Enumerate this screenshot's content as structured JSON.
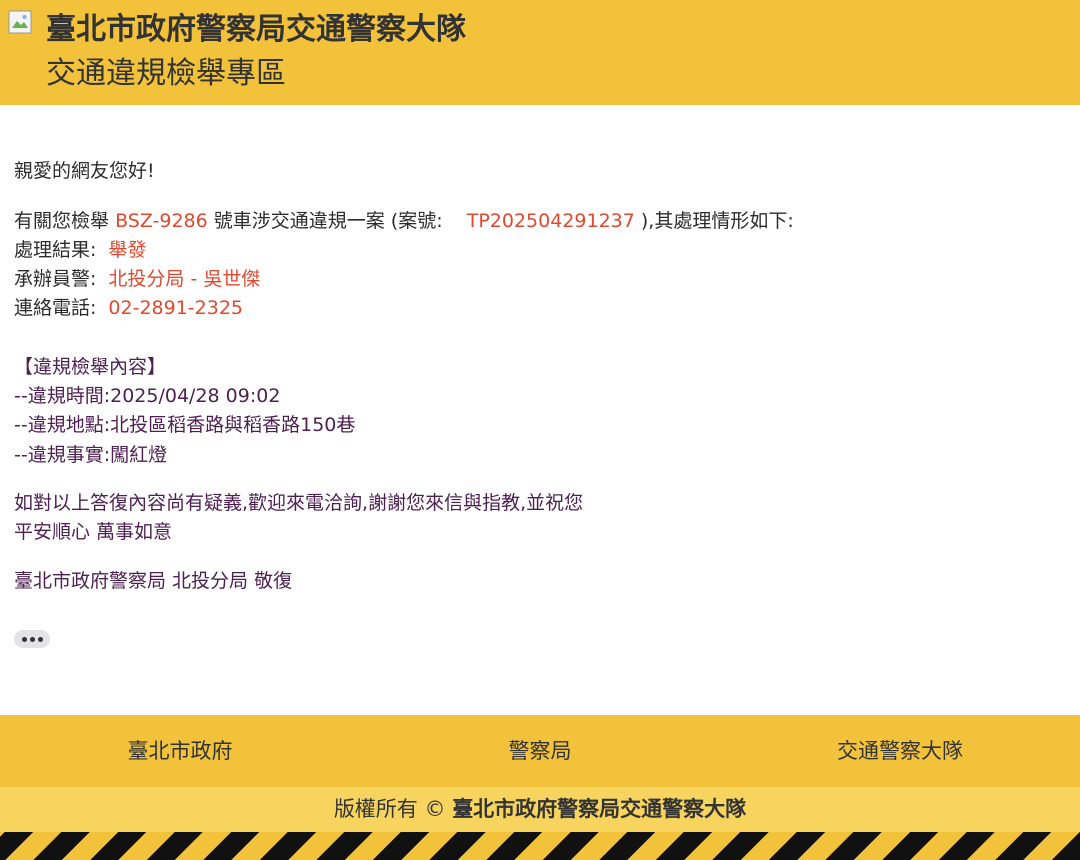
{
  "header": {
    "org_title": "臺北市政府警察局交通警察大隊",
    "section_title": "交通違規檢舉專區"
  },
  "message": {
    "greeting": "親愛的網友您好!",
    "intro_prefix": "有關您檢舉",
    "plate": "BSZ-9286",
    "intro_middle": "號車涉交通違規一案 (案號:",
    "case_number": "TP202504291237",
    "intro_suffix": "),其處理情形如下:",
    "result_label": "處理結果:",
    "result_value": "舉發",
    "officer_label": "承辦員警:",
    "officer_value": "北投分局 - 吳世傑",
    "phone_label": "連絡電話:",
    "phone_value": "02-2891-2325",
    "report_heading": "【違規檢舉內容】",
    "time_label": "--違規時間:",
    "time_value": "2025/04/28 09:02",
    "place_label": "--違規地點:",
    "place_value": "北投區稻香路與稻香路150巷",
    "fact_label": "--違規事實:",
    "fact_value": "闖紅燈",
    "closing_1": "如對以上答復內容尚有疑義,歡迎來電洽詢,謝謝您來信與指教,並祝您",
    "closing_2": "平安順心 萬事如意",
    "signature": "臺北市政府警察局 北投分局 敬復"
  },
  "footer": {
    "links": [
      "臺北市政府",
      "警察局",
      "交通警察大隊"
    ],
    "copyright_prefix": "版權所有 ©",
    "copyright_owner": "臺北市政府警察局交通警察大隊"
  },
  "colors": {
    "brand_yellow": "#f2c23a",
    "light_yellow": "#f6d45e",
    "highlight_red": "#e0492f",
    "closing_purple": "#4e1f52"
  }
}
